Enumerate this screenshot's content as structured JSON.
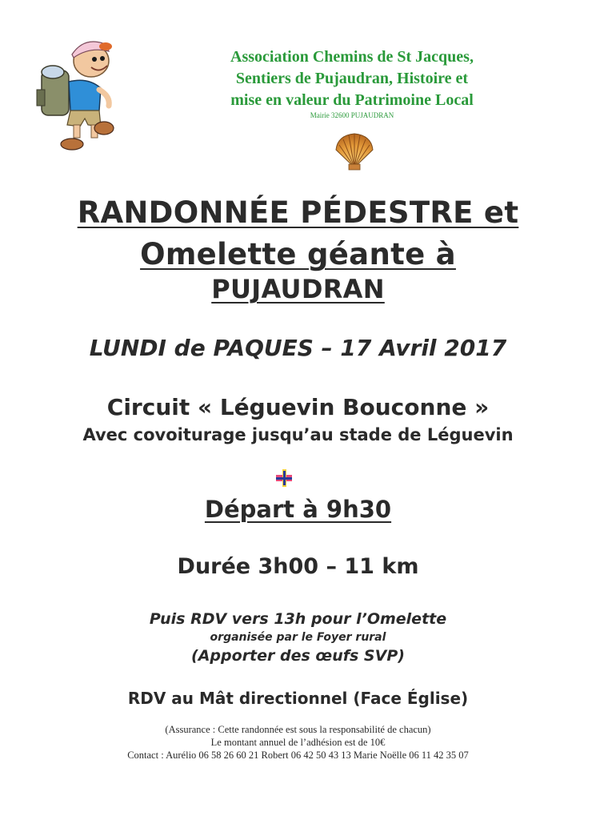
{
  "header": {
    "assoc_line1": "Association Chemins de St Jacques,",
    "assoc_line2": "Sentiers de Pujaudran, Histoire et",
    "assoc_line3": "mise en valeur du Patrimoine Local",
    "mairie": "Mairie  32600 PUJAUDRAN"
  },
  "title": {
    "line1": "RANDONNÉE PÉDESTRE et",
    "line2": "Omelette géante à",
    "line3": "PUJAUDRAN"
  },
  "event": {
    "date": "LUNDI de PAQUES – 17 Avril 2017",
    "circuit": "Circuit « Léguevin Bouconne »",
    "covoiturage": "Avec covoiturage jusqu’au stade de Léguevin",
    "depart": "Départ à 9h30",
    "duree": "Durée 3h00 – 11 km",
    "rdv_omelette": "Puis RDV vers 13h pour l’Omelette",
    "organisee": "organisée par le Foyer rural",
    "apporter": "(Apporter des œufs SVP)",
    "rdv_mat": "RDV au Mât directionnel (Face Église)"
  },
  "footer": {
    "assurance": "(Assurance : Cette randonnée est sous la responsabilité de chacun)",
    "montant": "Le montant annuel de l’adhésion est de 10€",
    "contact": "Contact : Aurélio 06 58 26 60 21 Robert 06 42 50 43 13  Marie Noëlle 06 11 42 35 07"
  },
  "colors": {
    "association_green": "#2a9a3a",
    "text": "#2b2b2b"
  },
  "icons": [
    "hiker-illustration",
    "scallop-shell-icon",
    "colored-cross-icon"
  ]
}
